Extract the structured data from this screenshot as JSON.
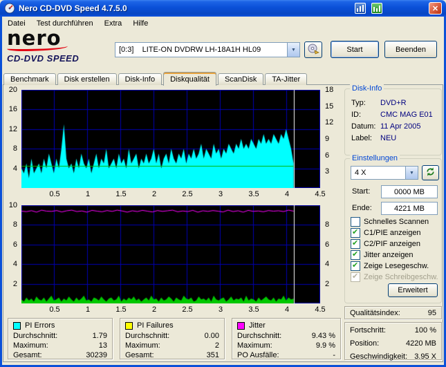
{
  "window": {
    "title": "Nero CD-DVD Speed 4.7.5.0"
  },
  "menu": {
    "items": [
      "Datei",
      "Test durchführen",
      "Extra",
      "Hilfe"
    ]
  },
  "header": {
    "logo_name": "nero",
    "logo_product": "CD-DVD SPEED",
    "drive_select_value": "[0:3]    LITE-ON DVDRW LH-18A1H HL09",
    "start_button": "Start",
    "quit_button": "Beenden"
  },
  "tabs": [
    {
      "label": "Benchmark",
      "active": false
    },
    {
      "label": "Disk erstellen",
      "active": false
    },
    {
      "label": "Disk-Info",
      "active": false
    },
    {
      "label": "Diskqualität",
      "active": true
    },
    {
      "label": "ScanDisk",
      "active": false
    },
    {
      "label": "TA-Jitter",
      "active": false
    }
  ],
  "disk_info": {
    "title": "Disk-Info",
    "rows": [
      {
        "label": "Typ:",
        "value": "DVD+R"
      },
      {
        "label": "ID:",
        "value": "CMC MAG E01"
      },
      {
        "label": "Datum:",
        "value": "11 Apr 2005"
      },
      {
        "label": "Label:",
        "value": "NEU"
      }
    ]
  },
  "settings": {
    "title": "Einstellungen",
    "speed": "4 X",
    "start_label": "Start:",
    "start_value": "0000 MB",
    "end_label": "Ende:",
    "end_value": "4221 MB",
    "checkboxes": [
      {
        "label": "Schnelles Scannen",
        "checked": false,
        "enabled": true
      },
      {
        "label": "C1/PIE anzeigen",
        "checked": true,
        "enabled": true
      },
      {
        "label": "C2/PIF anzeigen",
        "checked": true,
        "enabled": true
      },
      {
        "label": "Jitter anzeigen",
        "checked": true,
        "enabled": true
      },
      {
        "label": "Zeige Lesegeschw.",
        "checked": true,
        "enabled": true
      },
      {
        "label": "Zeige Schreibgeschw.",
        "checked": true,
        "enabled": false
      }
    ],
    "advanced_button": "Erweitert"
  },
  "quality": {
    "label": "Qualitätsindex:",
    "value": "95"
  },
  "progress": {
    "rows": [
      {
        "label": "Fortschritt:",
        "value": "100 %"
      },
      {
        "label": "Position:",
        "value": "4220 MB"
      },
      {
        "label": "Geschwindigkeit:",
        "value": "3.95 X"
      }
    ]
  },
  "stats": [
    {
      "title": "PI Errors",
      "color": "#00FFFF",
      "rows": [
        {
          "label": "Durchschnitt:",
          "value": "1.79"
        },
        {
          "label": "Maximum:",
          "value": "13"
        },
        {
          "label": "Gesamt:",
          "value": "30239"
        }
      ]
    },
    {
      "title": "PI Failures",
      "color": "#FFFF00",
      "rows": [
        {
          "label": "Durchschnitt:",
          "value": "0.00"
        },
        {
          "label": "Maximum:",
          "value": "2"
        },
        {
          "label": "Gesamt:",
          "value": "351"
        }
      ]
    },
    {
      "title": "Jitter",
      "color": "#FF00FF",
      "rows": [
        {
          "label": "Durchschnitt:",
          "value": "9.43 %"
        },
        {
          "label": "Maximum:",
          "value": "9.9 %"
        },
        {
          "label": "PO Ausfälle:",
          "value": "-"
        }
      ]
    }
  ],
  "chart_data": [
    {
      "type": "area",
      "title": "PI Errors vs. Position (GB)",
      "x_max": 4.5,
      "y_max": 20,
      "right_max": 18,
      "data_end_x": 4.1,
      "left_ticks": [
        "20",
        "16",
        "12",
        "8",
        "4"
      ],
      "right_ticks": [
        "18",
        "15",
        "12",
        "9",
        "6",
        "3"
      ],
      "x_ticks": [
        "0.5",
        "1",
        "1.5",
        "2",
        "2.5",
        "3",
        "3.5",
        "4",
        "4.5"
      ],
      "grid_y": [
        4,
        8,
        12,
        16
      ],
      "grid_color": "#0000B4",
      "bg": "#000000",
      "end_marker_color": "#FFFFFF",
      "series": [
        {
          "name": "PI Errors",
          "type": "area",
          "color": "#00FFFF",
          "values": [
            4,
            3,
            5,
            2,
            6,
            3,
            4,
            5,
            3,
            6,
            4,
            7,
            5,
            3,
            6,
            4,
            8,
            13,
            6,
            4,
            5,
            3,
            6,
            4,
            7,
            5,
            4,
            6,
            3,
            5,
            7,
            4,
            6,
            5,
            8,
            4,
            5,
            6,
            4,
            7,
            5,
            6,
            4,
            8,
            5,
            6,
            7,
            4,
            6,
            5,
            7,
            5,
            6,
            8,
            5,
            7,
            4,
            6,
            7,
            5,
            8,
            6,
            5,
            7,
            6,
            8,
            5,
            7,
            6,
            8,
            6,
            7,
            9,
            6,
            8,
            7,
            6,
            9,
            7,
            8,
            6,
            8,
            7,
            9,
            8,
            7,
            9,
            8,
            10,
            8,
            9,
            8,
            10,
            9,
            8,
            10,
            9,
            11,
            9,
            10,
            9,
            11,
            10,
            9,
            11,
            10,
            12,
            10,
            8,
            5
          ]
        },
        {
          "name": "Lesegeschwindigkeit",
          "type": "hline",
          "color": "#00B400",
          "y": 4,
          "scale": "right"
        }
      ]
    },
    {
      "type": "line",
      "title": "Jitter / PI Failures vs. Position (GB)",
      "x_max": 4.5,
      "y_max": 10,
      "right_max": 10,
      "data_end_x": 4.1,
      "left_ticks": [
        "10",
        "8",
        "6",
        "4",
        "2"
      ],
      "right_ticks": [
        "8",
        "6",
        "4",
        "2"
      ],
      "x_ticks": [
        "0.5",
        "1",
        "1.5",
        "2",
        "2.5",
        "3",
        "3.5",
        "4",
        "4.5"
      ],
      "grid_y": [
        2,
        4,
        6,
        8
      ],
      "grid_color": "#0000B4",
      "bg": "#000000",
      "end_marker_color": "#FFFFFF",
      "series": [
        {
          "name": "PI Failures",
          "type": "area",
          "color": "#00C800",
          "values": [
            0.4,
            0.2,
            0.6,
            0.3,
            0.5,
            0.2,
            0.7,
            0.4,
            0.3,
            0.6,
            0.2,
            0.5,
            0.8,
            0.3,
            0.4,
            0.6,
            0.2,
            0.5,
            0.3,
            0.7,
            0.4,
            0.2,
            0.6,
            0.3,
            0.5,
            0.8,
            0.3,
            0.4,
            0.2,
            0.6,
            0.5,
            0.3,
            0.7,
            0.4,
            0.2,
            0.5,
            0.6,
            0.3,
            0.4,
            0.8,
            0.2,
            0.5,
            0.3,
            0.6,
            0.4,
            0.7,
            0.3,
            0.5,
            0.2,
            0.4,
            0.6,
            0.3,
            0.8,
            0.4,
            0.5,
            0.2,
            0.6,
            0.3,
            0.4,
            0.7,
            0.5,
            0.2,
            0.6,
            0.4,
            0.3,
            0.8,
            0.5,
            0.4,
            0.6,
            0.2,
            0.3,
            0.7,
            0.4,
            0.5,
            0.3,
            0.6,
            0.2,
            0.8,
            0.4,
            0.3,
            0.5,
            0.6,
            0.2,
            0.4,
            0.7,
            0.3,
            0.5,
            0.4,
            0.6,
            0.2,
            0.8,
            0.3,
            0.5,
            0.4,
            0.2,
            0.6,
            0.3,
            0.5,
            0.7,
            0.4,
            0.3,
            0.6,
            0.2,
            0.5,
            0.4,
            0.8,
            0.3,
            0.6,
            0.4,
            0.5
          ]
        },
        {
          "name": "Jitter",
          "type": "line",
          "color": "#FF00FF",
          "values": [
            9.4,
            9.35,
            9.45,
            9.3,
            9.5,
            9.4,
            9.38,
            9.46,
            9.32,
            9.44,
            9.5,
            9.36,
            9.42,
            9.3,
            9.48,
            9.4,
            9.34,
            9.46,
            9.38,
            9.5,
            9.42,
            9.3,
            9.44,
            9.36,
            9.48,
            9.4,
            9.32,
            9.46,
            9.38,
            9.44,
            9.5,
            9.34,
            9.42,
            9.36,
            9.48,
            9.3,
            9.44,
            9.38,
            9.46,
            9.4,
            9.32,
            9.5,
            9.36,
            9.44,
            9.3,
            9.48,
            9.38,
            9.42,
            9.34,
            9.46,
            9.4,
            9.44,
            9.36,
            9.5,
            9.4
          ]
        }
      ]
    }
  ]
}
